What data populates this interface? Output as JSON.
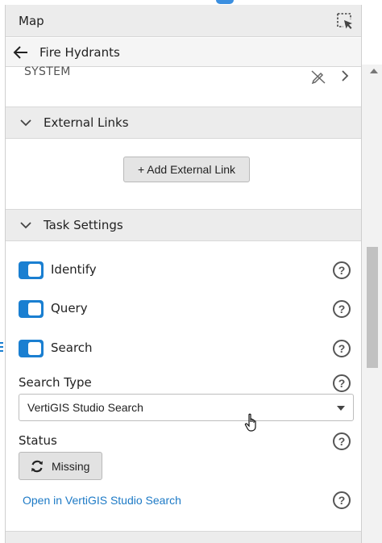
{
  "colors": {
    "accent": "#1a7fd1",
    "link": "#1d7ac6",
    "header_bg": "#ececec"
  },
  "map_header": {
    "title": "Map",
    "select_icon": "select-cursor-icon"
  },
  "layer_header": {
    "back_icon": "arrow-left-icon",
    "title": "Fire Hydrants"
  },
  "system_row": {
    "text": "SYSTEM",
    "icon": "edit-disabled-icon",
    "chevron_icon": "chevron-right-icon"
  },
  "external_links": {
    "title": "External Links",
    "add_button": "+ Add External Link"
  },
  "task_settings": {
    "title": "Task Settings",
    "toggles": [
      {
        "label": "Identify",
        "on": true
      },
      {
        "label": "Query",
        "on": true
      },
      {
        "label": "Search",
        "on": true
      }
    ],
    "search_type": {
      "label": "Search Type",
      "value": "VertiGIS Studio Search"
    },
    "status": {
      "label": "Status",
      "button": "Missing"
    },
    "open_link": "Open in VertiGIS Studio Search",
    "help_glyph": "?"
  }
}
